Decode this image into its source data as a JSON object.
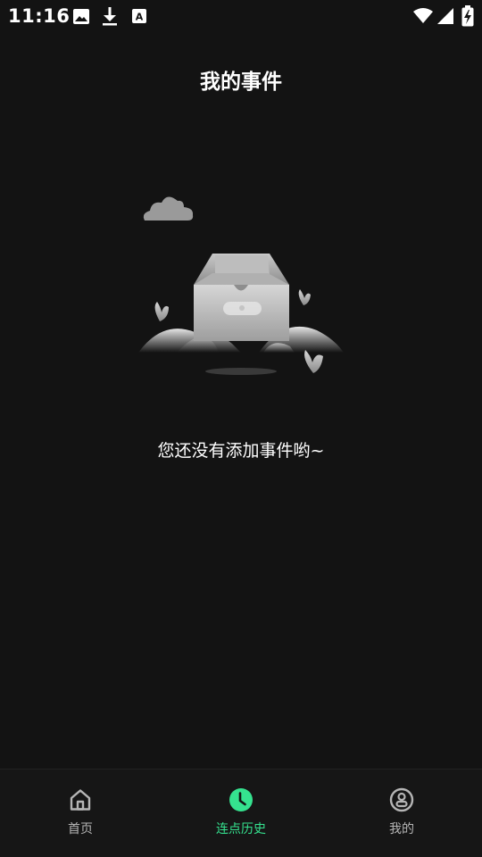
{
  "status_bar": {
    "time": "11:16",
    "left_icons": [
      "image-icon",
      "download-icon",
      "font-icon"
    ],
    "right_icons": [
      "wifi-icon",
      "signal-icon",
      "battery-charging-icon"
    ]
  },
  "header": {
    "title": "我的事件"
  },
  "empty_state": {
    "illustration": "empty-box-icon",
    "message": "您还没有添加事件哟~"
  },
  "bottom_nav": {
    "items": [
      {
        "label": "首页",
        "icon": "home-icon",
        "active": false
      },
      {
        "label": "连点历史",
        "icon": "clock-icon",
        "active": true
      },
      {
        "label": "我的",
        "icon": "profile-icon",
        "active": false
      }
    ],
    "active_color": "#35e28f",
    "inactive_color": "#b5b5b5"
  },
  "colors": {
    "background": "#131313",
    "accent": "#35e28f"
  }
}
